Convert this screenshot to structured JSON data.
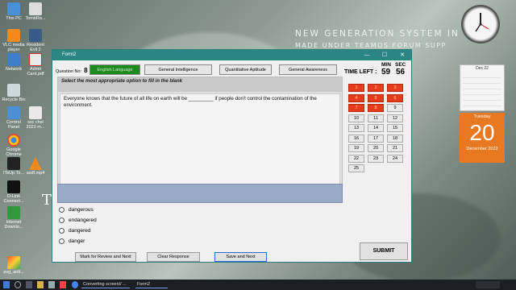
{
  "desktop": {
    "watermark_line1": "NEW GENERATION SYSTEM IN",
    "watermark_line2": "MADE UNDER TEAMOS FORUM SUPP",
    "icons": [
      {
        "label": "This PC"
      },
      {
        "label": "TombRa..."
      },
      {
        "label": "VLC media player"
      },
      {
        "label": "Resident Evil 2"
      },
      {
        "label": "Network"
      },
      {
        "label": "Admit Card.pdf"
      },
      {
        "label": "Recycle Bin"
      },
      {
        "label": "Control Panel"
      },
      {
        "label": "ssc chsl 2022 m..."
      },
      {
        "label": "Google Chrome"
      },
      {
        "label": "ITsUp To..."
      },
      {
        "label": "asdf.mp4"
      },
      {
        "label": "D-Link Connect..."
      },
      {
        "label": "Internet Downlo..."
      },
      {
        "label": "avg_anti..."
      }
    ],
    "calendar_month": "Dec 22",
    "calendar_weekday": "Tuesday",
    "calendar_day": "20",
    "calendar_month_year": "December 2022"
  },
  "window": {
    "title": "Form2",
    "minimize": "—",
    "maximize": "☐",
    "close": "✕"
  },
  "header": {
    "question_no_label": "Question No:",
    "question_no_value": "8",
    "tabs": [
      {
        "label": "English Language"
      },
      {
        "label": "General Intelligence"
      },
      {
        "label": "Quantitative Aptitude"
      },
      {
        "label": "General Awareness"
      }
    ],
    "timer_label": "TIME LEFT :",
    "min_label": "MIN",
    "sec_label": "SEC",
    "min_value": "59",
    "sec_value": "56"
  },
  "question": {
    "instruction": "Select the most appropriate option to fill in the blank",
    "text": "Everyone knows that the future of all life on earth will be _________ if people don't control the contamination of the environment."
  },
  "options": [
    {
      "label": "dangerous"
    },
    {
      "label": "endangered"
    },
    {
      "label": "dangered"
    },
    {
      "label": "danger"
    }
  ],
  "buttons": {
    "mark_review": "Mark for Review and Next",
    "clear": "Clear Response",
    "save_next": "Save and Next",
    "submit": "SUBMIT"
  },
  "question_grid": [
    {
      "label": "1",
      "state": "answered"
    },
    {
      "label": "2",
      "state": "answered"
    },
    {
      "label": "3",
      "state": "answered"
    },
    {
      "label": "4",
      "state": "answered"
    },
    {
      "label": "5",
      "state": "answered"
    },
    {
      "label": "6",
      "state": "answered"
    },
    {
      "label": "7",
      "state": "answered"
    },
    {
      "label": "8",
      "state": "answered"
    },
    {
      "label": "9",
      "state": "none"
    },
    {
      "label": "10",
      "state": "none"
    },
    {
      "label": "11",
      "state": "none"
    },
    {
      "label": "12",
      "state": "none"
    },
    {
      "label": "13",
      "state": "none"
    },
    {
      "label": "14",
      "state": "none"
    },
    {
      "label": "15",
      "state": "none"
    },
    {
      "label": "16",
      "state": "none"
    },
    {
      "label": "17",
      "state": "none"
    },
    {
      "label": "18",
      "state": "none"
    },
    {
      "label": "19",
      "state": "none"
    },
    {
      "label": "20",
      "state": "none"
    },
    {
      "label": "21",
      "state": "none"
    },
    {
      "label": "22",
      "state": "none"
    },
    {
      "label": "23",
      "state": "none"
    },
    {
      "label": "24",
      "state": "none"
    },
    {
      "label": "25",
      "state": "none"
    }
  ],
  "taskbar": {
    "item1": "Converting screen// ...",
    "item2": "Form2"
  },
  "colors": {
    "answered": "#e63b1c",
    "active_tab": "#1f8b1f",
    "titlebar": "#2a8585",
    "calendar_accent": "#e87920"
  }
}
